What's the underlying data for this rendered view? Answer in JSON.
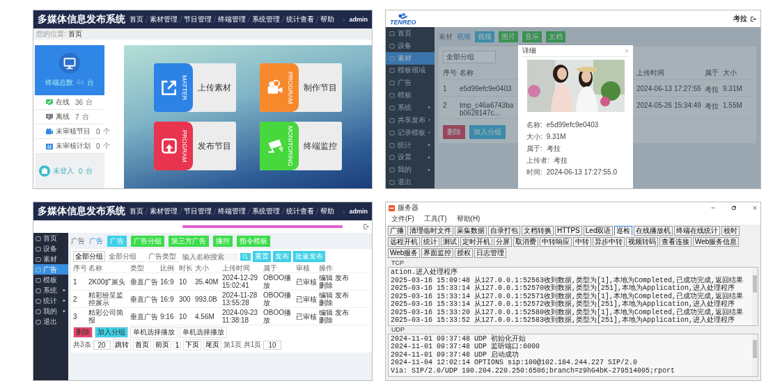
{
  "home": {
    "title": "多媒体信息发布系统",
    "nav": [
      "首页",
      "素材管理",
      "节目管理",
      "终端管理",
      "系统管理",
      "统计查看",
      "帮助"
    ],
    "user": "admin",
    "breadcrumb_label": "您的位置:",
    "breadcrumb_current": "首页",
    "total": {
      "label": "终端总数",
      "count": "44",
      "unit": "台"
    },
    "stats": [
      {
        "kind": "online",
        "color": "#3cc35a",
        "label": "在线",
        "count": "36",
        "unit": "台"
      },
      {
        "kind": "offline",
        "color": "#7a7f87",
        "label": "离线",
        "count": "7",
        "unit": "台"
      },
      {
        "kind": "program",
        "color": "#2f86e6",
        "label": "未审核节目",
        "count": "0",
        "unit": "个"
      },
      {
        "kind": "plan",
        "color": "#2f86e6",
        "label": "未审核计划",
        "count": "0",
        "unit": "个"
      }
    ],
    "not_logged": {
      "label": "未登入",
      "count": "0",
      "unit": "台"
    },
    "tiles": [
      {
        "kind": "upload",
        "color": "#2d82e6",
        "tag": "MATTER",
        "label": "上传素材"
      },
      {
        "kind": "camera",
        "color": "#f7892d",
        "tag": "PROGRAM",
        "label": "制作节目"
      },
      {
        "kind": "publish",
        "color": "#e8344f",
        "tag": "PROGRAM",
        "label": "发布节目"
      },
      {
        "kind": "monitor",
        "color": "#46d83c",
        "tag": "MONITORING",
        "label": "终端监控"
      }
    ]
  },
  "material": {
    "brand": "TENREO",
    "user": "考拉",
    "sidebar": [
      {
        "label": "首页",
        "selected": false,
        "expandable": false
      },
      {
        "label": "设备",
        "selected": false,
        "expandable": false
      },
      {
        "label": "素材",
        "selected": true,
        "expandable": false
      },
      {
        "label": "模板领域",
        "selected": false,
        "expandable": false
      },
      {
        "label": "广告",
        "selected": false,
        "expandable": false
      },
      {
        "label": "模板",
        "selected": false,
        "expandable": false
      },
      {
        "label": "系统",
        "selected": false,
        "expandable": true
      },
      {
        "label": "共享发布",
        "selected": false,
        "expandable": true
      },
      {
        "label": "记录模板",
        "selected": false,
        "expandable": true
      },
      {
        "label": "统计",
        "selected": false,
        "expandable": true
      },
      {
        "label": "设置",
        "selected": false,
        "expandable": true
      },
      {
        "label": "我的",
        "selected": false,
        "expandable": true
      },
      {
        "label": "退出",
        "selected": false,
        "expandable": false
      }
    ],
    "breadcrumb": [
      "素材",
      "视频"
    ],
    "tags": [
      {
        "label": "视频",
        "selected": true
      },
      {
        "label": "图片",
        "selected": false
      },
      {
        "label": "音乐",
        "selected": false
      },
      {
        "label": "文档",
        "selected": false
      }
    ],
    "group_select": "全部分组",
    "columns": [
      "序号",
      "名称",
      "上传时间",
      "属于",
      "大小"
    ],
    "rows": [
      {
        "index": "1",
        "name": "e5d99efc9e0403",
        "time": "2024-06-13 17:27:55",
        "owner": "考拉",
        "size": "9.31M"
      },
      {
        "index": "2",
        "name": "tmp_c46a6743bab0628147c...",
        "time": "2024-05-26 15:34:49",
        "owner": "考拉",
        "size": "1.55M"
      }
    ],
    "buttons": [
      {
        "label": "删除",
        "kind": "danger"
      },
      {
        "label": "加入分组",
        "kind": "primary"
      }
    ],
    "modal": {
      "title": "详细",
      "fields": [
        {
          "label": "名称:",
          "value": "e5d99efc9e0403"
        },
        {
          "label": "大小:",
          "value": "9.31M"
        },
        {
          "label": "属于:",
          "value": "考拉"
        },
        {
          "label": "上传者:",
          "value": "考拉"
        },
        {
          "label": "时间:",
          "value": "2024-06-13 17:27:55.0"
        }
      ]
    }
  },
  "ads": {
    "title": "多媒体信息发布系统",
    "nav": [
      "首页",
      "素材管理",
      "节目管理",
      "终端管理",
      "系统管理",
      "统计查看",
      "帮助"
    ],
    "user": "admin",
    "sidebar": [
      {
        "label": "首页",
        "selected": false,
        "expandable": false
      },
      {
        "label": "设备",
        "selected": false,
        "expandable": false
      },
      {
        "label": "素材",
        "selected": false,
        "expandable": false
      },
      {
        "label": "广告",
        "selected": true,
        "expandable": false
      },
      {
        "label": "模板",
        "selected": false,
        "expandable": false
      },
      {
        "label": "系统",
        "selected": false,
        "expandable": true
      },
      {
        "label": "统计",
        "selected": false,
        "expandable": true
      },
      {
        "label": "我的",
        "selected": false,
        "expandable": true
      },
      {
        "label": "退出",
        "selected": false,
        "expandable": false
      }
    ],
    "breadcrumb": [
      "广告",
      "广告"
    ],
    "tags": [
      {
        "label": "广告",
        "color": "#3fd0e8"
      },
      {
        "label": "广告分组",
        "color": "#3ddc4a"
      },
      {
        "label": "第三方广告",
        "color": "#3ddc4a"
      },
      {
        "label": "播控",
        "color": "#3ddc4a"
      },
      {
        "label": "指令模板",
        "color": "#3ddc4a"
      }
    ],
    "filter_button": "全部分组",
    "select_all": "全部分组",
    "select_type": "广告类型",
    "search_placeholder": "输入名称搜索",
    "actions": [
      "重置",
      "发布",
      "批量发布"
    ],
    "columns": [
      "序号",
      "名称",
      "类型",
      "比例",
      "时长",
      "大小",
      "上传时间",
      "属于",
      "审核",
      "操作"
    ],
    "rows": [
      {
        "index": "1",
        "name": "2K00扩展头",
        "type": "垂直广告",
        "ratio": "16:9",
        "duration": "10",
        "size": "35.40M",
        "time": "2024-12-29 15:02:41",
        "owner": "OBOO播放",
        "status": "已审核",
        "ops": [
          "编辑",
          "发布",
          "删除"
        ]
      },
      {
        "index": "2",
        "name": "精彩纷呈监控展示",
        "type": "垂直广告",
        "ratio": "16:9",
        "duration": "300",
        "size": "993.0B",
        "time": "2024-11-28 13:55:28",
        "owner": "OBOO播放",
        "status": "已审核",
        "ops": [
          "编辑",
          "发布",
          "删除"
        ]
      },
      {
        "index": "3",
        "name": "精彩公司简报",
        "type": "垂直广告",
        "ratio": "9:16",
        "duration": "10",
        "size": "4.56M",
        "time": "2024-09-23 11:38:18",
        "owner": "OBOO播放",
        "status": "已审核",
        "ops": [
          "编辑",
          "发布",
          "删除"
        ]
      }
    ],
    "buttons": [
      {
        "label": "删除",
        "color": "#e8436b"
      },
      {
        "label": "加入分组",
        "color": "#3fd0e8"
      },
      {
        "label": "单机选择播放",
        "color": "#ffffff"
      },
      {
        "label": "单机选择播放",
        "color": "#ffffff"
      }
    ],
    "pager": {
      "total": "共3条",
      "page_size": "20",
      "goto": "跳转",
      "first": "首页",
      "prev": "前页",
      "current": "1",
      "next": "下页",
      "last": "尾页",
      "count": "第1页",
      "pages": "共1页",
      "per_page": "10"
    }
  },
  "server": {
    "title": "服务器",
    "menu": [
      "文件(F)",
      "工具(T)",
      "帮助(H)"
    ],
    "tools": [
      {
        "label": "广播",
        "selected": false
      },
      {
        "label": "清理临时文件",
        "selected": false
      },
      {
        "label": "采集数据",
        "selected": false
      },
      {
        "label": "自录打包",
        "selected": false
      },
      {
        "label": "文档转换",
        "selected": false
      },
      {
        "label": "HTTPS",
        "selected": false
      },
      {
        "label": "Led双语",
        "selected": false
      },
      {
        "label": "巡检",
        "selected": true
      },
      {
        "label": "在线播放机",
        "selected": false
      },
      {
        "label": "终端在线统计",
        "selected": false
      },
      {
        "label": "校时",
        "selected": false
      },
      {
        "label": "远程开机",
        "selected": false
      },
      {
        "label": "统计",
        "selected": false
      },
      {
        "label": "测试",
        "selected": false
      },
      {
        "label": "定时开机",
        "selected": false
      },
      {
        "label": "分屏",
        "selected": false
      },
      {
        "label": "取消费",
        "selected": false
      },
      {
        "label": "中转响应",
        "selected": false
      },
      {
        "label": "中转",
        "selected": false
      },
      {
        "label": "异步中转",
        "selected": false
      },
      {
        "label": "视频转码",
        "selected": false
      },
      {
        "label": "查看连接",
        "selected": false
      },
      {
        "label": "Web服务信息",
        "selected": false
      },
      {
        "label": "Web服务",
        "selected": false
      },
      {
        "label": "界面监控",
        "selected": false
      },
      {
        "label": "授权",
        "selected": false
      },
      {
        "label": "日志管理",
        "selected": false
      }
    ],
    "tcp_label": "TCP",
    "tcp_lines": [
      "ation.进入处理程序",
      "2025-03-16 15:09:48 从127.0.0.1:52563收到数据,类型为[1],本地为Completed,已成功完成,返回结果",
      "2025-03-16 15:33:14 从127.0.0.1:52570收到数据,类型为[251],本地为Application,进入处理程序",
      "2025-03-16 15:33:14 从127.0.0.1:52571收到数据,类型为[1],本地为Completed,已成功完成,返回结果",
      "2025-03-16 15:33:14 从127.0.0.1:52572收到数据,类型为[251],本地为Application,进入处理程序",
      "2025-03-16 15:33:20 从127.0.0.1:52580收到数据,类型为[1],本地为Completed,已成功完成,返回结果",
      "2025-03-16 15:33:52 从127.0.0.1:52583收到数据,类型为[251],本地为Application,进入处理程序"
    ],
    "udp_label": "UDP",
    "udp_lines": [
      "2024-11-01 09:37:48 UDP 初始化开始",
      "2024-11-01 09:37:48 UDP 监听端口:6000",
      "2024-11-01 09:37:48 UDP 启动成功",
      "2024-11-04 12:02:14 OPTIONS sip:100@102.184.244.227 SIP/2.0",
      "Via: SIP/2.0/UDP 190.204.220.250:6506;branch=z9hG4bK-279514005;rport"
    ]
  }
}
